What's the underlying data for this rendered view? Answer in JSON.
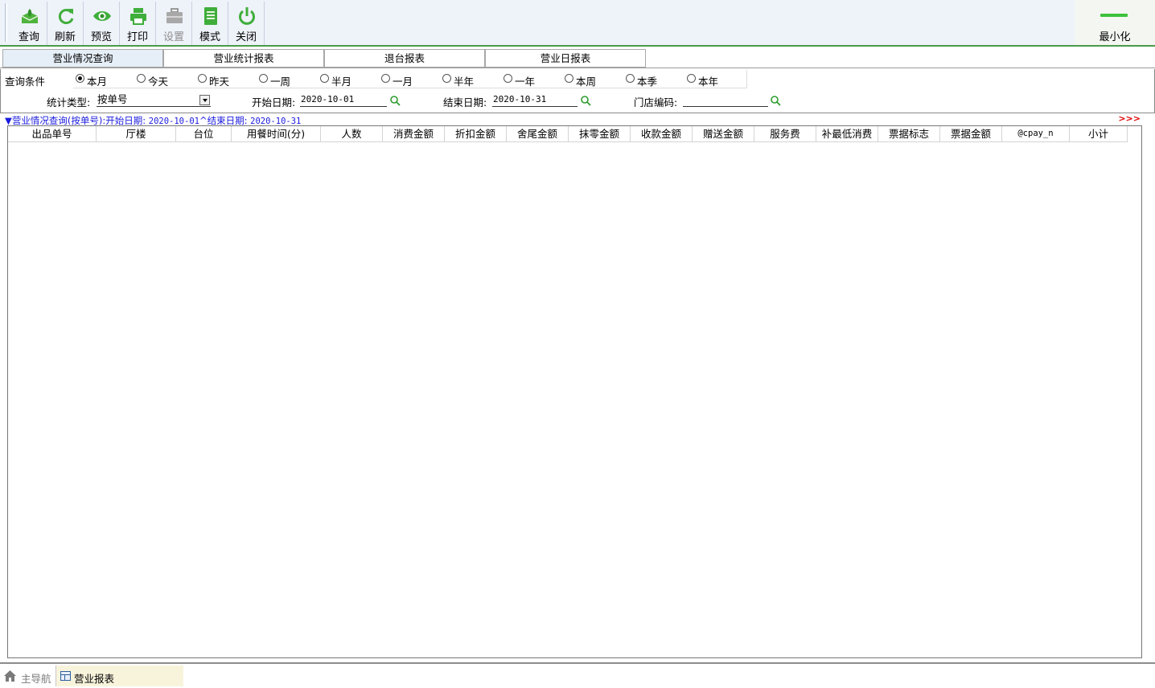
{
  "toolbar": {
    "buttons": [
      {
        "label": "查询",
        "icon": "query-icon",
        "disabled": false
      },
      {
        "label": "刷新",
        "icon": "refresh-icon",
        "disabled": false
      },
      {
        "label": "预览",
        "icon": "eye-icon",
        "disabled": false
      },
      {
        "label": "打印",
        "icon": "printer-icon",
        "disabled": false
      },
      {
        "label": "设置",
        "icon": "toolbox-icon",
        "disabled": true
      },
      {
        "label": "模式",
        "icon": "document-icon",
        "disabled": false
      },
      {
        "label": "关闭",
        "icon": "power-icon",
        "disabled": false
      }
    ],
    "minimize_label": "最小化"
  },
  "tabs": [
    {
      "label": "营业情况查询",
      "active": true
    },
    {
      "label": "营业统计报表",
      "active": false
    },
    {
      "label": "退台报表",
      "active": false
    },
    {
      "label": "营业日报表",
      "active": false
    }
  ],
  "query": {
    "label": "查询条件",
    "ranges": [
      {
        "label": "本月",
        "selected": true
      },
      {
        "label": "今天",
        "selected": false
      },
      {
        "label": "昨天",
        "selected": false
      },
      {
        "label": "一周",
        "selected": false
      },
      {
        "label": "半月",
        "selected": false
      },
      {
        "label": "一月",
        "selected": false
      },
      {
        "label": "半年",
        "selected": false
      },
      {
        "label": "一年",
        "selected": false
      },
      {
        "label": "本周",
        "selected": false
      },
      {
        "label": "本季",
        "selected": false
      },
      {
        "label": "本年",
        "selected": false
      }
    ],
    "stat_type_label": "统计类型:",
    "stat_type_value": "按单号",
    "start_label": "开始日期:",
    "start_value": "2020-10-01",
    "end_label": "结束日期:",
    "end_value": "2020-10-31",
    "store_label": "门店编码:",
    "store_value": ""
  },
  "report": {
    "toggle": "▼",
    "title": "营业情况查询(按单号)",
    "start_label": ":开始日期:",
    "start_value": "2020-10-01",
    "sep": "^",
    "end_label": "结束日期:",
    "end_value": "2020-10-31",
    "expand": ">>>",
    "columns": [
      "出品单号",
      "厅楼",
      "台位",
      "用餐时间(分)",
      "人数",
      "消费金额",
      "折扣金额",
      "舍尾金额",
      "抹零金额",
      "收款金额",
      "赠送金额",
      "服务费",
      "补最低消费",
      "票据标志",
      "票据金额",
      "@cpay_n",
      "小计"
    ],
    "rows": []
  },
  "bottom": {
    "home_label": "主导航",
    "report_label": "营业报表"
  },
  "colors": {
    "accent_green": "#3cc23c",
    "link_blue": "#1a1adf",
    "expand_red": "#e00000"
  }
}
